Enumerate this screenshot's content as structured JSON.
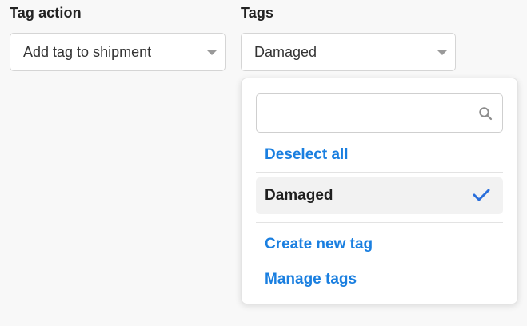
{
  "tag_action": {
    "label": "Tag action",
    "selected": "Add tag to shipment"
  },
  "tags": {
    "label": "Tags",
    "selected": "Damaged"
  },
  "dropdown": {
    "search": {
      "value": "",
      "placeholder": "",
      "icon": "search-icon"
    },
    "deselect_all": "Deselect all",
    "options": [
      {
        "label": "Damaged",
        "checked": true,
        "icon": "check-icon"
      }
    ],
    "create_new_tag": "Create new tag",
    "manage_tags": "Manage tags"
  },
  "colors": {
    "link": "#1a7fe0",
    "check": "#2a6fdb",
    "selected_option_bg": "#f2f2f2"
  }
}
